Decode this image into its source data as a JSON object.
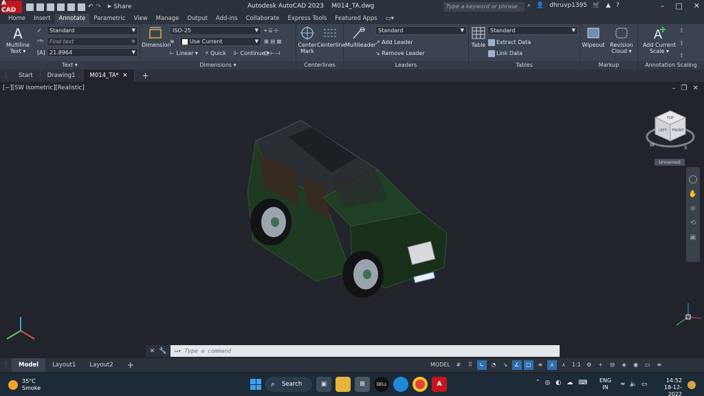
{
  "titlebar": {
    "app_badge": "A CAD",
    "share_label": "Share",
    "app_title": "Autodesk AutoCAD 2023",
    "file_name": "M014_TA.dwg",
    "search_placeholder": "Type a keyword or phrase",
    "username": "dhruvp1395"
  },
  "ribbon_tabs": [
    "Home",
    "Insert",
    "Annotate",
    "Parametric",
    "View",
    "Manage",
    "Output",
    "Add-ins",
    "Collaborate",
    "Express Tools",
    "Featured Apps"
  ],
  "ribbon": {
    "text_panel": {
      "title": "Text",
      "multiline_label": "Multiline Text",
      "style_value": "Standard",
      "find_placeholder": "Find text",
      "height_value": "21.8964"
    },
    "dimensions_panel": {
      "title": "Dimensions",
      "dimension_label": "Dimension",
      "dimstyle_value": "ISO-25",
      "layer_value": "Use Current",
      "linear_label": "Linear",
      "quick_label": "Quick",
      "continue_label": "Continue"
    },
    "centerlines_panel": {
      "title": "Centerlines",
      "center_mark_label": "Center Mark",
      "centerline_label": "Centerline"
    },
    "leaders_panel": {
      "title": "Leaders",
      "multileader_label": "Multileader",
      "style_value": "Standard",
      "add_leader_label": "Add Leader",
      "remove_leader_label": "Remove Leader"
    },
    "tables_panel": {
      "title": "Tables",
      "table_label": "Table",
      "style_value": "Standard",
      "extract_label": "Extract Data",
      "link_label": "Link Data"
    },
    "markup_panel": {
      "title": "Markup",
      "wipeout_label": "Wipeout",
      "revision_label": "Revision Cloud"
    },
    "scaling_panel": {
      "title": "Annotation Scaling",
      "add_scale_label": "Add Current Scale"
    }
  },
  "file_tabs": [
    "Start",
    "Drawing1",
    "M014_TA*"
  ],
  "viewport": {
    "label": "[−][SW Isometric][Realistic]",
    "viewcube_top": "TOP",
    "viewcube_left": "LEFT",
    "viewcube_front": "FRONT",
    "compass_w": "W",
    "compass_s": "S",
    "unnamed_label": "Unnamed"
  },
  "command": {
    "placeholder": "Type a command"
  },
  "layout_tabs": [
    "Model",
    "Layout1",
    "Layout2"
  ],
  "status": {
    "model_label": "MODEL",
    "scale_label": "1:1"
  },
  "taskbar": {
    "temp": "35°C",
    "condition": "Smoke",
    "search_label": "Search",
    "lang_line1": "ENG",
    "lang_line2": "IN",
    "time": "14:52",
    "date": "18-12-2022"
  },
  "colors": {
    "vehicle_body": "#1f3d24",
    "accent_blue": "#2f6fb0",
    "autocad_red": "#c4161c"
  }
}
